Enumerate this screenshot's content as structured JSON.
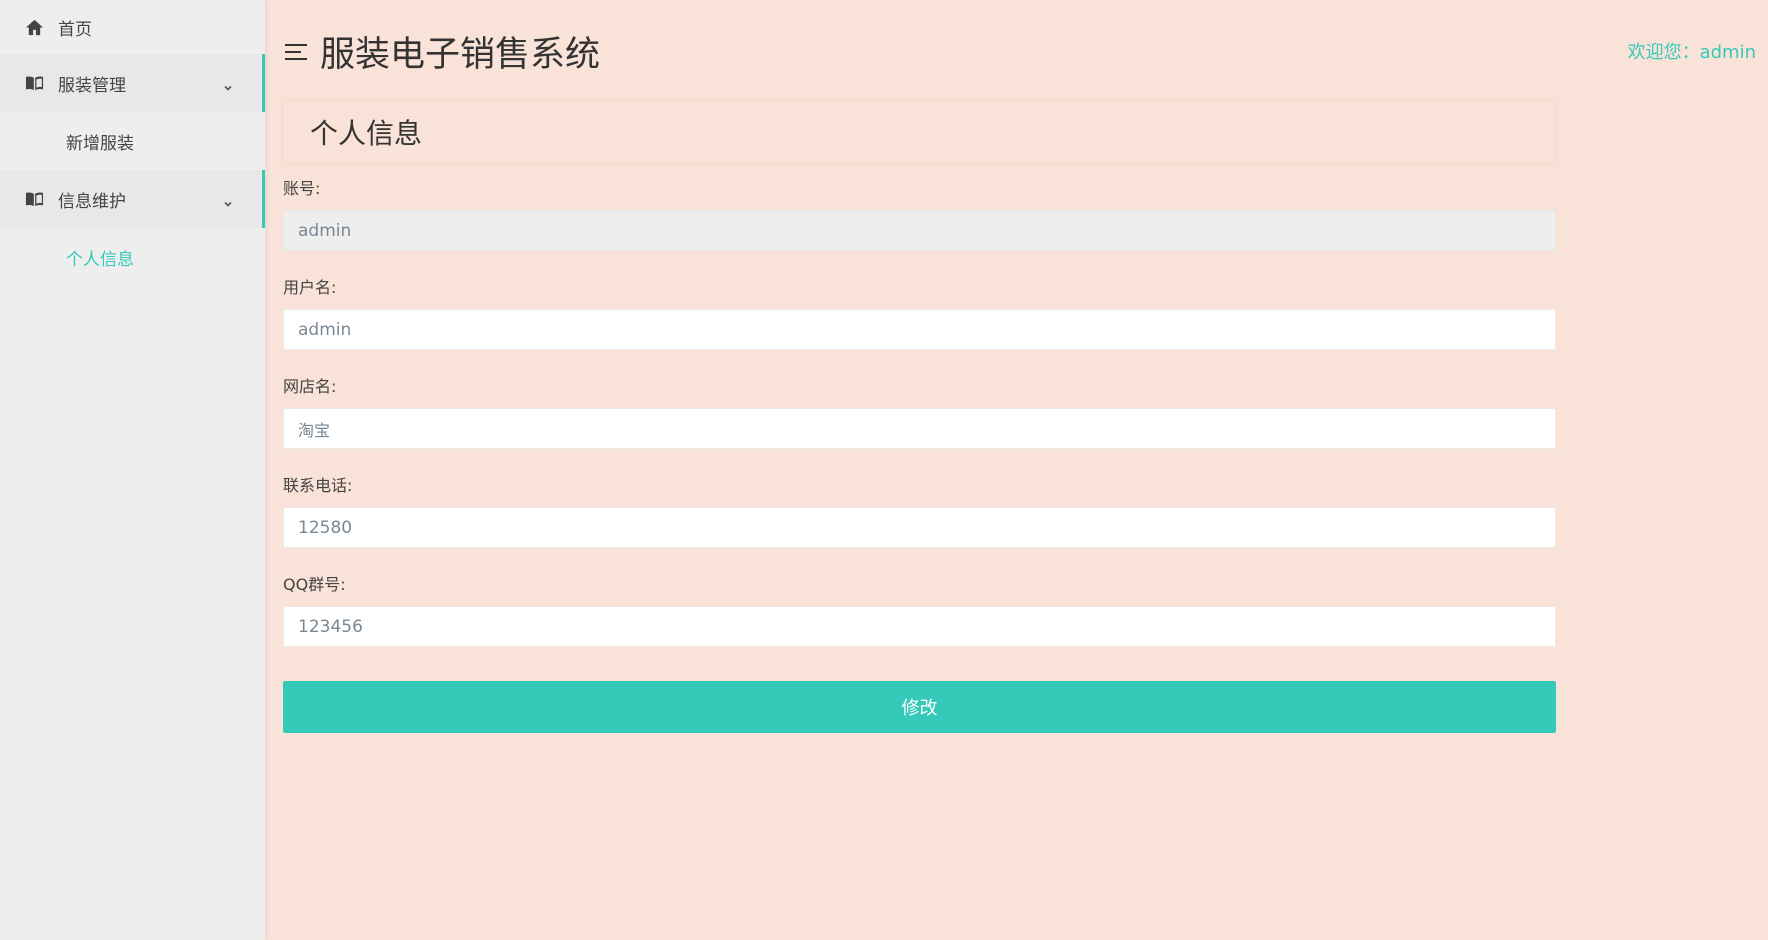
{
  "app": {
    "title": "服装电子销售系统",
    "welcome": "欢迎您：admin",
    "accent_color": "#35c9ba",
    "background_color": "#f9e2d8"
  },
  "sidebar": {
    "home": {
      "label": "首页",
      "icon": "home-icon"
    },
    "groups": [
      {
        "label": "服装管理",
        "icon": "book-icon",
        "items": [
          "新增服装"
        ]
      },
      {
        "label": "信息维护",
        "icon": "book-icon",
        "items": [
          "个人信息"
        ]
      }
    ],
    "active_item": "个人信息"
  },
  "panel": {
    "title": "个人信息"
  },
  "form": {
    "account": {
      "label": "账号:",
      "value": "admin"
    },
    "username": {
      "label": "用户名:",
      "value": "admin"
    },
    "shop_name": {
      "label": "网店名:",
      "value": "淘宝"
    },
    "phone": {
      "label": "联系电话:",
      "value": "12580"
    },
    "qq_group": {
      "label": "QQ群号:",
      "value": "123456"
    },
    "submit_label": "修改"
  }
}
